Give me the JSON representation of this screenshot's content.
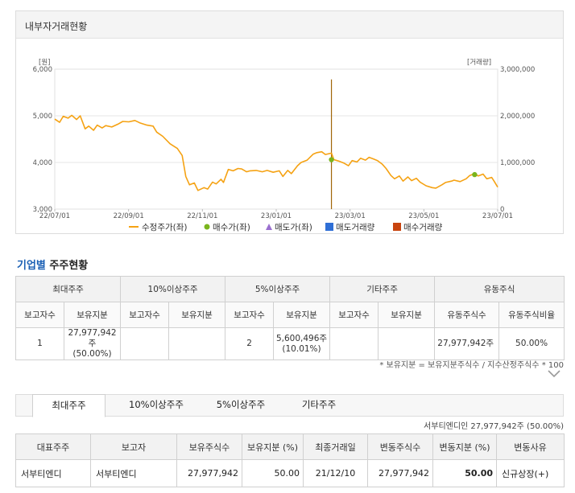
{
  "chart_panel": {
    "title": "내부자거래현황"
  },
  "chart_data": {
    "type": "line",
    "title": "",
    "y_left": {
      "unit": "[원]",
      "min": 3000,
      "max": 6000,
      "ticks": [
        "6,000",
        "5,000",
        "4,000",
        "3,000"
      ]
    },
    "y_right": {
      "unit": "[거래량]",
      "min": 0,
      "max": 3000000,
      "ticks": [
        "3,000,000",
        "2,000,000",
        "1,000,000",
        "0"
      ]
    },
    "x_ticks": [
      "22/07/01",
      "22/09/01",
      "22/11/01",
      "23/01/01",
      "23/03/01",
      "23/05/01",
      "23/07/01"
    ],
    "x_range": [
      "2022-07-01",
      "2023-07-01"
    ],
    "price_series": {
      "name": "수정주가(좌)",
      "color": "#f5a213",
      "points": [
        [
          "2022-07-01",
          4930
        ],
        [
          "2022-07-05",
          4860
        ],
        [
          "2022-07-08",
          4990
        ],
        [
          "2022-07-12",
          4950
        ],
        [
          "2022-07-15",
          5010
        ],
        [
          "2022-07-19",
          4920
        ],
        [
          "2022-07-22",
          5000
        ],
        [
          "2022-07-26",
          4720
        ],
        [
          "2022-07-29",
          4780
        ],
        [
          "2022-08-02",
          4690
        ],
        [
          "2022-08-05",
          4800
        ],
        [
          "2022-08-09",
          4740
        ],
        [
          "2022-08-12",
          4790
        ],
        [
          "2022-08-17",
          4760
        ],
        [
          "2022-08-22",
          4820
        ],
        [
          "2022-08-26",
          4880
        ],
        [
          "2022-08-31",
          4870
        ],
        [
          "2022-09-05",
          4900
        ],
        [
          "2022-09-09",
          4850
        ],
        [
          "2022-09-15",
          4800
        ],
        [
          "2022-09-20",
          4780
        ],
        [
          "2022-09-23",
          4650
        ],
        [
          "2022-09-28",
          4560
        ],
        [
          "2022-10-04",
          4400
        ],
        [
          "2022-10-10",
          4300
        ],
        [
          "2022-10-14",
          4150
        ],
        [
          "2022-10-17",
          3700
        ],
        [
          "2022-10-20",
          3520
        ],
        [
          "2022-10-24",
          3560
        ],
        [
          "2022-10-27",
          3400
        ],
        [
          "2022-11-01",
          3460
        ],
        [
          "2022-11-04",
          3430
        ],
        [
          "2022-11-08",
          3580
        ],
        [
          "2022-11-11",
          3540
        ],
        [
          "2022-11-15",
          3640
        ],
        [
          "2022-11-17",
          3570
        ],
        [
          "2022-11-21",
          3850
        ],
        [
          "2022-11-25",
          3820
        ],
        [
          "2022-11-29",
          3870
        ],
        [
          "2022-12-02",
          3860
        ],
        [
          "2022-12-06",
          3800
        ],
        [
          "2022-12-09",
          3820
        ],
        [
          "2022-12-14",
          3830
        ],
        [
          "2022-12-19",
          3800
        ],
        [
          "2022-12-23",
          3830
        ],
        [
          "2022-12-28",
          3790
        ],
        [
          "2023-01-02",
          3820
        ],
        [
          "2023-01-05",
          3700
        ],
        [
          "2023-01-09",
          3830
        ],
        [
          "2023-01-12",
          3760
        ],
        [
          "2023-01-17",
          3930
        ],
        [
          "2023-01-20",
          4000
        ],
        [
          "2023-01-25",
          4050
        ],
        [
          "2023-01-30",
          4180
        ],
        [
          "2023-02-02",
          4210
        ],
        [
          "2023-02-06",
          4230
        ],
        [
          "2023-02-09",
          4170
        ],
        [
          "2023-02-14",
          4200
        ],
        [
          "2023-02-16",
          4060
        ],
        [
          "2023-02-20",
          4030
        ],
        [
          "2023-02-24",
          3990
        ],
        [
          "2023-02-28",
          3930
        ],
        [
          "2023-03-03",
          4040
        ],
        [
          "2023-03-07",
          4010
        ],
        [
          "2023-03-10",
          4090
        ],
        [
          "2023-03-14",
          4050
        ],
        [
          "2023-03-17",
          4110
        ],
        [
          "2023-03-21",
          4070
        ],
        [
          "2023-03-24",
          4040
        ],
        [
          "2023-03-28",
          3960
        ],
        [
          "2023-03-31",
          3870
        ],
        [
          "2023-04-04",
          3720
        ],
        [
          "2023-04-07",
          3650
        ],
        [
          "2023-04-11",
          3710
        ],
        [
          "2023-04-14",
          3600
        ],
        [
          "2023-04-18",
          3690
        ],
        [
          "2023-04-21",
          3610
        ],
        [
          "2023-04-25",
          3660
        ],
        [
          "2023-04-28",
          3580
        ],
        [
          "2023-05-03",
          3500
        ],
        [
          "2023-05-08",
          3460
        ],
        [
          "2023-05-11",
          3450
        ],
        [
          "2023-05-16",
          3520
        ],
        [
          "2023-05-19",
          3570
        ],
        [
          "2023-05-24",
          3600
        ],
        [
          "2023-05-26",
          3620
        ],
        [
          "2023-05-31",
          3590
        ],
        [
          "2023-06-05",
          3650
        ],
        [
          "2023-06-08",
          3720
        ],
        [
          "2023-06-12",
          3760
        ],
        [
          "2023-06-15",
          3710
        ],
        [
          "2023-06-19",
          3750
        ],
        [
          "2023-06-22",
          3650
        ],
        [
          "2023-06-26",
          3680
        ],
        [
          "2023-06-28",
          3600
        ],
        [
          "2023-07-01",
          3470
        ]
      ]
    },
    "buy_points": {
      "name": "매수가(좌)",
      "color": "#7ab51d",
      "points": [
        [
          "2023-02-14",
          4060
        ],
        [
          "2023-06-12",
          3740
        ]
      ]
    },
    "sell_points": {
      "name": "매도가(좌)",
      "color": "#9a6fcf",
      "points": []
    },
    "sell_volume": {
      "name": "매도거래량",
      "color": "#2f6fd6",
      "bars": []
    },
    "buy_volume": {
      "name": "매수거래량",
      "color": "#c8440f",
      "bars": [],
      "marker_color": "#a06608",
      "marker": [
        "2023-02-14",
        2780000
      ]
    },
    "grid": true,
    "legend_position": "bottom"
  },
  "section": {
    "title_accent": "기업별",
    "title_rest": " 주주현황"
  },
  "holder_table": {
    "groups": [
      "최대주주",
      "10%이상주주",
      "5%이상주주",
      "기타주주",
      "유동주식"
    ],
    "subheaders": [
      "보고자수",
      "보유지분",
      "보고자수",
      "보유지분",
      "보고자수",
      "보유지분",
      "보고자수",
      "보유지분",
      "유동주식수",
      "유동주식비율"
    ],
    "row": [
      "1",
      "27,977,942주",
      "(50.00%)",
      "",
      "",
      "2",
      "5,600,496주",
      "(10.01%)",
      "",
      "",
      "27,977,942주",
      "50.00%"
    ]
  },
  "footnote": "* 보유지분 = 보유지분주식수 / 지수산정주식수 * 100",
  "tabs": [
    "최대주주",
    "10%이상주주",
    "5%이상주주",
    "기타주주"
  ],
  "tab_summary": "서부티엔디인 27,977,942주 (50.00%)",
  "detail_table": {
    "headers": [
      "대표주주",
      "보고자",
      "보유주식수",
      "보유지분 (%)",
      "최종거래일",
      "변동주식수",
      "변동지분 (%)",
      "변동사유"
    ],
    "rows": [
      [
        "서부티엔디",
        "서부티엔디",
        "27,977,942",
        "50.00",
        "21/12/10",
        "27,977,942",
        "50.00",
        "신규상장(+)"
      ]
    ]
  }
}
